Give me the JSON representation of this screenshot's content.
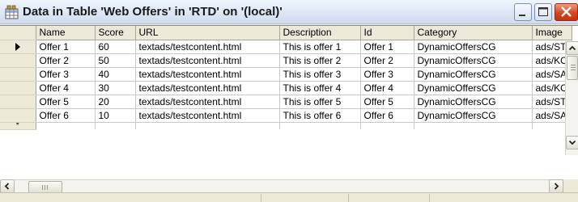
{
  "window": {
    "title": "Data in Table 'Web Offers' in 'RTD' on '(local)'",
    "icon": "table-icon",
    "controls": [
      "minimize-icon",
      "maximize-icon",
      "close-icon"
    ]
  },
  "grid": {
    "columns": [
      "Name",
      "Score",
      "URL",
      "Description",
      "Id",
      "Category",
      "Image"
    ],
    "current_row_indicator": "►",
    "new_row_indicator": "*",
    "rows": [
      [
        "Offer 1",
        "60",
        "textads/testcontent.html",
        "This is offer 1",
        "Offer 1",
        "DynamicOffersCG",
        "ads/ST"
      ],
      [
        "Offer 2",
        "50",
        "textads/testcontent.html",
        "This is offer 2",
        "Offer 2",
        "DynamicOffersCG",
        "ads/KO"
      ],
      [
        "Offer 3",
        "40",
        "textads/testcontent.html",
        "This is offer 3",
        "Offer 3",
        "DynamicOffersCG",
        "ads/SA"
      ],
      [
        "Offer 4",
        "30",
        "textads/testcontent.html",
        "This is offer 4",
        "Offer 4",
        "DynamicOffersCG",
        "ads/KO"
      ],
      [
        "Offer 5",
        "20",
        "textads/testcontent.html",
        "This is offer 5",
        "Offer 5",
        "DynamicOffersCG",
        "ads/ST"
      ],
      [
        "Offer 6",
        "10",
        "textads/testcontent.html",
        "This is offer 6",
        "Offer 6",
        "DynamicOffersCG",
        "ads/SA"
      ]
    ]
  },
  "scrollbars": {
    "up": "▲",
    "down": "▼",
    "left": "◄",
    "right": "►"
  },
  "colors": {
    "titlebar": "#dfe9f6",
    "close_button": "#d5471f",
    "grid_line": "#c9c9c9",
    "header_bg": "#ece9d8"
  }
}
